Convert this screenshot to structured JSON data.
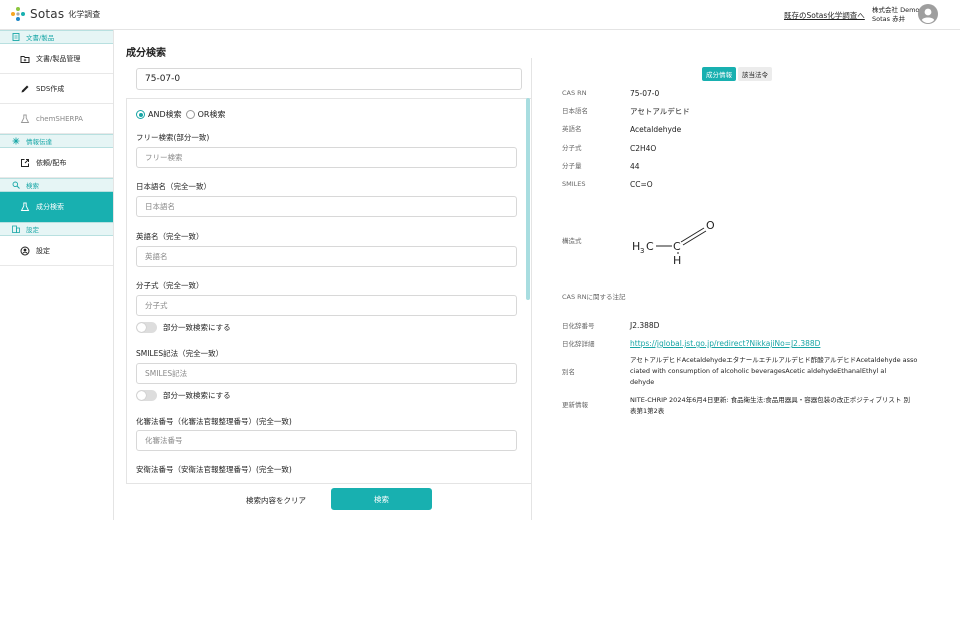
{
  "header": {
    "logo_text": "Sotas",
    "logo_sub": "化学調査",
    "legacy_link": "既存のSotas化学調査へ",
    "company": "株式会社 Demo",
    "user": "Sotas 赤井"
  },
  "sidebar": {
    "sections": [
      {
        "label": "文書/製品",
        "icon": "document-icon"
      },
      {
        "label": "情報伝達",
        "icon": "share-icon"
      },
      {
        "label": "検索",
        "icon": "search-icon"
      },
      {
        "label": "設定",
        "icon": "building-icon"
      }
    ],
    "items": [
      {
        "label": "文書/製品管理",
        "icon": "folder-icon"
      },
      {
        "label": "SDS作成",
        "icon": "pencil-icon"
      },
      {
        "label": "chemSHERPA",
        "icon": "flask-icon"
      },
      {
        "label": "依頼/配布",
        "icon": "export-icon"
      },
      {
        "label": "成分検索",
        "icon": "flask-icon"
      },
      {
        "label": "設定",
        "icon": "user-circle-icon"
      }
    ]
  },
  "search": {
    "title": "成分検索",
    "cas_value": "75-07-0",
    "mode_and": "AND検索",
    "mode_or": "OR検索",
    "fields": [
      {
        "label": "フリー検索(部分一致)",
        "placeholder": "フリー検索"
      },
      {
        "label": "日本語名（完全一致）",
        "placeholder": "日本語名"
      },
      {
        "label": "英語名（完全一致）",
        "placeholder": "英語名"
      },
      {
        "label": "分子式（完全一致）",
        "placeholder": "分子式"
      },
      {
        "label": "SMILES記法（完全一致）",
        "placeholder": "SMILES記法"
      },
      {
        "label": "化審法番号（化審法官報整理番号）(完全一致)",
        "placeholder": "化審法番号"
      },
      {
        "label": "安衛法番号（安衛法官報整理番号）(完全一致)",
        "placeholder": ""
      }
    ],
    "partial_toggle": "部分一致検索にする",
    "clear_label": "検索内容をクリア",
    "search_label": "検索"
  },
  "detail": {
    "tabs": [
      "成分情報",
      "該当法令"
    ],
    "rows": [
      {
        "label": "CAS RN",
        "value": "75-07-0"
      },
      {
        "label": "日本語名",
        "value": "アセトアルデヒド"
      },
      {
        "label": "英語名",
        "value": "Acetaldehyde"
      },
      {
        "label": "分子式",
        "value": "C2H4O"
      },
      {
        "label": "分子量",
        "value": "44"
      },
      {
        "label": "SMILES",
        "value": "CC=O"
      }
    ],
    "structure_label": "構造式",
    "structure": {
      "h3": "H",
      "sub3": "3",
      "c1": "C",
      "c2": "C",
      "o": "O",
      "h": "H"
    },
    "cas_note_label": "CAS RNに関する注記",
    "nikka_no_label": "日化辞番号",
    "nikka_no": "J2.388D",
    "nikka_detail_label": "日化辞詳細",
    "nikka_link": "https://jglobal.jst.go.jp/redirect?NikkajiNo=J2.388D",
    "alias_label": "別名",
    "alias_line1": "アセトアルデヒドAcetaldehydeエタナールエチルアルデヒド酢酸アルデヒドAcetaldehyde asso",
    "alias_line2": "ciated with consumption of alcoholic beveragesAcetic aldehydeEthanalEthyl al",
    "alias_line3": "dehyde",
    "update_label": "更新情報",
    "update_line1": "NITE-CHRIP 2024年6月4日更新: 食品衛生法:食品用器具・容器包装の改正ポジティブリスト 別",
    "update_line2": "表第1第2表"
  },
  "colors": {
    "accent": "#18b0b0",
    "accent_light": "#e6f5f5"
  }
}
